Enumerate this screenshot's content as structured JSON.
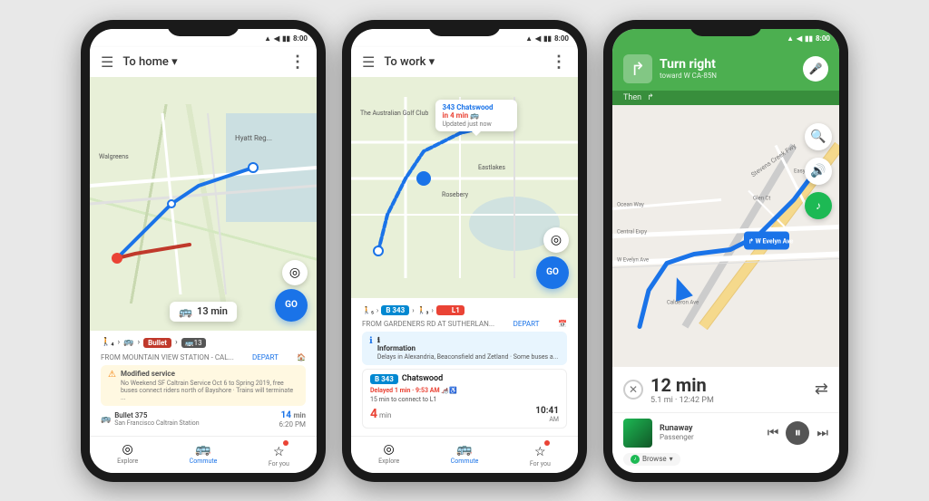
{
  "phones": [
    {
      "id": "phone1",
      "header": {
        "title": "To home ▾",
        "menuLabel": "☰",
        "moreLabel": "⋮"
      },
      "statusBar": {
        "time": "8:00",
        "icons": "▲ ◀ ⬜ ⬜"
      },
      "mapBubble": {
        "icon": "🚌",
        "text": "13 min"
      },
      "routeOptions": {
        "walkIcon": "🚶",
        "tag": "Bullet",
        "arrow": ">",
        "busIcon": "🚌",
        "busNum": "13"
      },
      "fromLabel": "FROM MOUNTAIN VIEW STATION - CAL...",
      "departLabel": "DEPART",
      "alert": {
        "icon": "⚠",
        "text": "Modified service\nNo Weekend SF Caltrain Service Oct 6 to Spring 2019, free buses connect riders north of Bayshore · Trains will terminate ..."
      },
      "schedule": {
        "icon": "🚌",
        "name": "Bullet 375",
        "station": "San Francisco Caltrain Station",
        "mins": "14",
        "time": "6:20",
        "meridiem": "PM"
      },
      "bottomNav": [
        {
          "label": "Explore",
          "icon": "◎",
          "active": false
        },
        {
          "label": "Commute",
          "icon": "🚌",
          "active": true
        },
        {
          "label": "For you",
          "icon": "☆",
          "active": false,
          "badge": true
        }
      ]
    },
    {
      "id": "phone2",
      "header": {
        "title": "To work ▾",
        "menuLabel": "☰",
        "moreLabel": "⋮"
      },
      "statusBar": {
        "time": "8:00"
      },
      "mapBubble": {
        "routeNum": "343",
        "routeName": "Chatswood",
        "timeText": "in 4 min",
        "updated": "Updated just now"
      },
      "routeOptions": {
        "walk1": "🚶₅",
        "bus1": "B 343",
        "walk2": "🚶₃",
        "trainTag": "L L1"
      },
      "fromLabel": "FROM GARDENERS RD AT SUTHERLAN...",
      "departLabel": "DEPART",
      "infoCard": {
        "icon": "ℹ",
        "text": "Information\nDelays in Alexandria, Beaconsfield and Zetland · Some buses a..."
      },
      "busCard": {
        "tag": "B 343",
        "name": "Chatswood",
        "delayed": "Delayed 1 min · 9:53 AM",
        "connect": "15 min to connect to L1",
        "mins": "4",
        "arrivalTime": "10:41",
        "meridiem": "AM"
      },
      "bottomNav": [
        {
          "label": "Explore",
          "icon": "◎",
          "active": false
        },
        {
          "label": "Commute",
          "icon": "🚌",
          "active": true
        },
        {
          "label": "For you",
          "icon": "☆",
          "active": false,
          "badge": true
        }
      ]
    },
    {
      "id": "phone3",
      "statusBar": {
        "time": "8:00",
        "green": true
      },
      "navHeader": {
        "turnIcon": "↱",
        "direction": "Turn right",
        "toward": "toward W CA-85N",
        "micIcon": "🎤"
      },
      "thenBar": {
        "label": "Then",
        "icon": "↱"
      },
      "mapStreets": [
        "Stevens Creek Fwy",
        "Central Expy",
        "W Evelyn Ave",
        "Calderon Ave",
        "Easy St",
        "Glen Ct",
        "Ocean Way"
      ],
      "mapControls": [
        {
          "icon": "🔍",
          "label": "search"
        },
        {
          "icon": "🔊",
          "label": "volume"
        },
        {
          "icon": "♪",
          "label": "spotify",
          "green": true
        }
      ],
      "etaBar": {
        "cancelIcon": "✕",
        "time": "12 min",
        "details": "5.1 mi · 12:42 PM",
        "routeIcon": "⇄"
      },
      "musicPlayer": {
        "songTitle": "Runaway",
        "artist": "Passenger",
        "prevIcon": "⏮",
        "playIcon": "⏸",
        "nextIcon": "⏭",
        "browseLabel": "Browse",
        "browseLogo": "♪"
      }
    }
  ]
}
